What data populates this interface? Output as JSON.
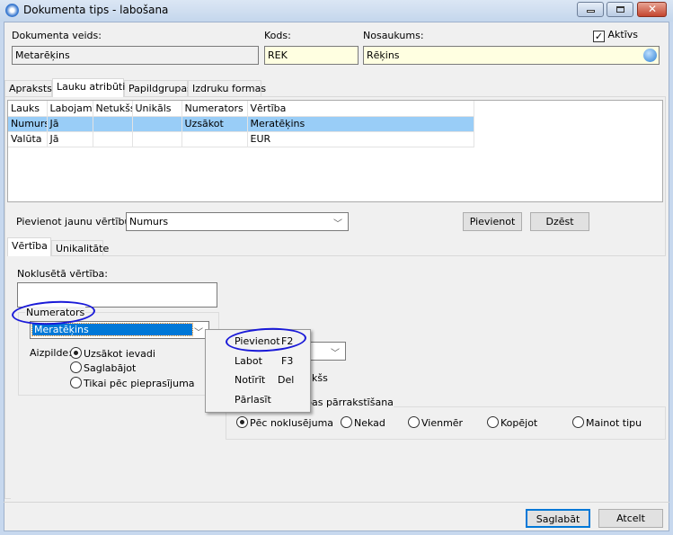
{
  "window": {
    "title": "Dokumenta tips - labošana",
    "minimize_icon": "minimize-icon",
    "maximize_icon": "maximize-icon",
    "close_icon": "close-icon"
  },
  "header": {
    "doc_type_label": "Dokumenta veids:",
    "doc_type_value": "Metarēķins",
    "code_label": "Kods:",
    "code_value": "REK",
    "name_label": "Nosaukums:",
    "name_value": "Rēķins",
    "active_label": "Aktīvs",
    "active_checked": true
  },
  "tabs": [
    "Apraksts",
    "Lauku atribūti",
    "Papildgrupas",
    "Izdruku formas"
  ],
  "grid": {
    "columns": [
      "Lauks",
      "Labojams",
      "Netukšs",
      "Unikāls",
      "Numerators",
      "Vērtība"
    ],
    "rows": [
      [
        "Numurs",
        "Jā",
        "",
        "",
        "Uzsākot",
        "Meratēķins"
      ],
      [
        "Valūta",
        "Jā",
        "",
        "",
        "",
        "EUR"
      ]
    ]
  },
  "add_value": {
    "label": "Pievienot jaunu vērtību:",
    "select_value": "Numurs",
    "add_button": "Pievienot",
    "delete_button": "Dzēst"
  },
  "inner_tabs": [
    "Vērtība",
    "Unikalitāte"
  ],
  "value_tab": {
    "default_label": "Noklusētā vērtība:",
    "default_value": "",
    "numerator_group": "Numerators",
    "numerator_value": "Meratēķins",
    "fill_label": "Aizpilde:",
    "fill_options": [
      "Uzsākot ievadi",
      "Saglabājot",
      "Tikai pēc pieprasījuma"
    ],
    "fill_selected": 0,
    "partial_checkbox_label": "kšs",
    "overwrite_group": "bas pārrakstīšana",
    "overwrite_options": [
      "Pēc noklusējuma",
      "Nekad",
      "Vienmēr",
      "Kopējot",
      "Mainot tipu"
    ],
    "overwrite_selected": 0
  },
  "context_menu": [
    {
      "label": "Pievienot",
      "shortcut": "F2"
    },
    {
      "label": "Labot",
      "shortcut": "F3"
    },
    {
      "label": "Notīrīt",
      "shortcut": "Del"
    },
    {
      "label": "Pārlasīt",
      "shortcut": ""
    }
  ],
  "footer": {
    "save": "Saglabāt",
    "cancel": "Atcelt"
  },
  "colors": {
    "selection": "#99cdf7",
    "highlight": "#0078d7",
    "annotation": "#1a1ad8",
    "input_yellow": "#ffffe1"
  }
}
